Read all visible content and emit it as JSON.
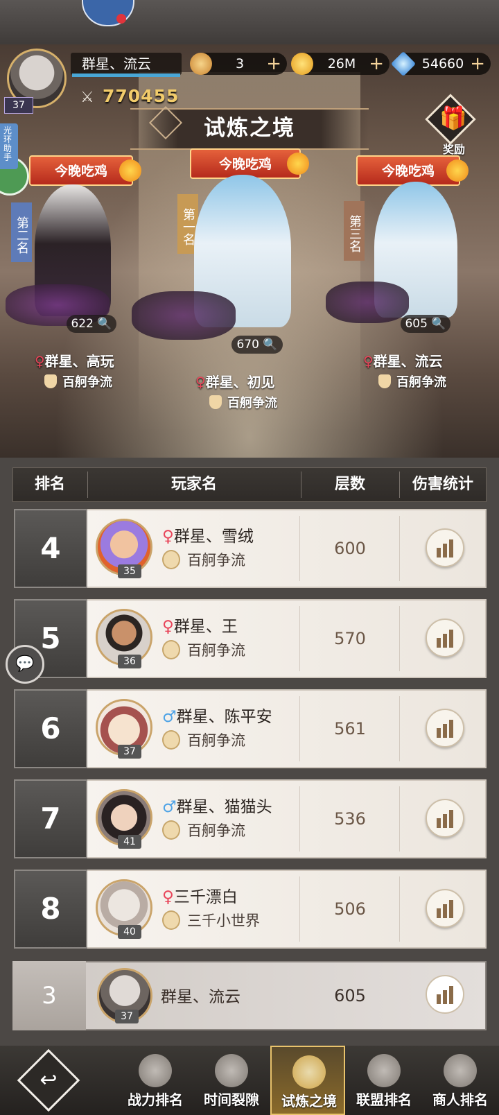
{
  "header": {
    "player_name": "群星、流云",
    "player_level": "37",
    "power": "770455",
    "resources": [
      {
        "icon": "medal-coin-icon",
        "value": "3"
      },
      {
        "icon": "gold-coin-icon",
        "value": "26M"
      },
      {
        "icon": "diamond-icon",
        "value": "54660"
      }
    ],
    "plus": "+"
  },
  "assistant": {
    "label": "光环助手"
  },
  "title": "试炼之境",
  "reward_label": "奖励",
  "podium": {
    "tag": "今晚吃鸡",
    "entries": [
      {
        "rank_label": "第二名",
        "floors": "622",
        "name": "群星、高玩",
        "gender": "♀",
        "guild": "百舸争流"
      },
      {
        "rank_label": "第一名",
        "floors": "670",
        "name": "群星、初见",
        "gender": "♀",
        "guild": "百舸争流"
      },
      {
        "rank_label": "第三名",
        "floors": "605",
        "name": "群星、流云",
        "gender": "♀",
        "guild": "百舸争流"
      }
    ]
  },
  "table": {
    "headers": [
      "排名",
      "玩家名",
      "层数",
      "伤害统计"
    ],
    "rows": [
      {
        "rank": "4",
        "gender": "♀",
        "name": "群星、雪绒",
        "guild": "百舸争流",
        "floors": "600",
        "level": "35"
      },
      {
        "rank": "5",
        "gender": "♀",
        "name": "群星、王",
        "guild": "百舸争流",
        "floors": "570",
        "level": "36"
      },
      {
        "rank": "6",
        "gender": "♂",
        "name": "群星、陈平安",
        "guild": "百舸争流",
        "floors": "561",
        "level": "37"
      },
      {
        "rank": "7",
        "gender": "♂",
        "name": "群星、猫猫头",
        "guild": "百舸争流",
        "floors": "536",
        "level": "41"
      },
      {
        "rank": "8",
        "gender": "♀",
        "name": "三千漂白",
        "guild": "三千小世界",
        "floors": "506",
        "level": "40"
      }
    ]
  },
  "my_rank": {
    "rank": "3",
    "name": "群星、流云",
    "floors": "605",
    "level": "37"
  },
  "bottom_nav": [
    {
      "label": "战力排名",
      "active": false
    },
    {
      "label": "时间裂隙",
      "active": false
    },
    {
      "label": "试炼之境",
      "active": true
    },
    {
      "label": "联盟排名",
      "active": false
    },
    {
      "label": "商人排名",
      "active": false
    }
  ],
  "colors": {
    "female": "#e8455a",
    "male": "#4fa3e6",
    "power": "#f2cc6b",
    "active_tab": "#e9c36c"
  }
}
